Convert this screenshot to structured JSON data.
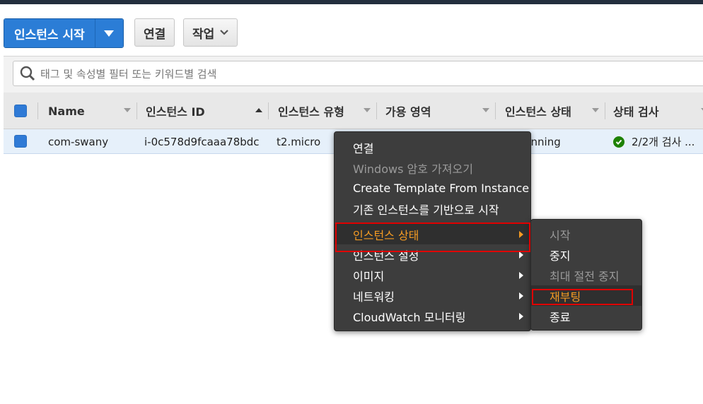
{
  "toolbar": {
    "launch_label": "인스턴스 시작",
    "connect_label": "연결",
    "actions_label": "작업"
  },
  "search": {
    "placeholder": "태그 및 속성별 필터 또는 키워드별 검색"
  },
  "table": {
    "columns": [
      "Name",
      "인스턴스 ID",
      "인스턴스 유형",
      "가용 영역",
      "인스턴스 상태",
      "상태 검사"
    ],
    "rows": [
      {
        "name": "com-swany",
        "instance_id": "i-0c578d9fcaaa78bdc",
        "instance_type": "t2.micro",
        "state": "unning",
        "status_check": "2/2개 검사 ..."
      }
    ]
  },
  "context_menu": {
    "items": [
      {
        "label": "연결",
        "enabled": true
      },
      {
        "label": "Windows 암호 가져오기",
        "enabled": false
      },
      {
        "label": "Create Template From Instance",
        "enabled": true
      },
      {
        "label": "기존 인스턴스를 기반으로 시작",
        "enabled": true
      },
      {
        "label": "인스턴스 상태",
        "enabled": true,
        "submenu": true,
        "active": true
      },
      {
        "label": "인스턴스 설정",
        "enabled": true,
        "submenu": true
      },
      {
        "label": "이미지",
        "enabled": true,
        "submenu": true
      },
      {
        "label": "네트워킹",
        "enabled": true,
        "submenu": true
      },
      {
        "label": "CloudWatch 모니터링",
        "enabled": true,
        "submenu": true
      }
    ]
  },
  "submenu": {
    "items": [
      {
        "label": "시작",
        "enabled": false
      },
      {
        "label": "중지",
        "enabled": true
      },
      {
        "label": "최대 절전 중지",
        "enabled": false
      },
      {
        "label": "재부팅",
        "enabled": true,
        "active": true
      },
      {
        "label": "종료",
        "enabled": true
      }
    ]
  },
  "colors": {
    "primary": "#2b7dd6",
    "menu_bg": "#3d3d3d",
    "active_text": "#f39a23",
    "highlight": "#e00000",
    "status_ok": "#1d8102"
  }
}
